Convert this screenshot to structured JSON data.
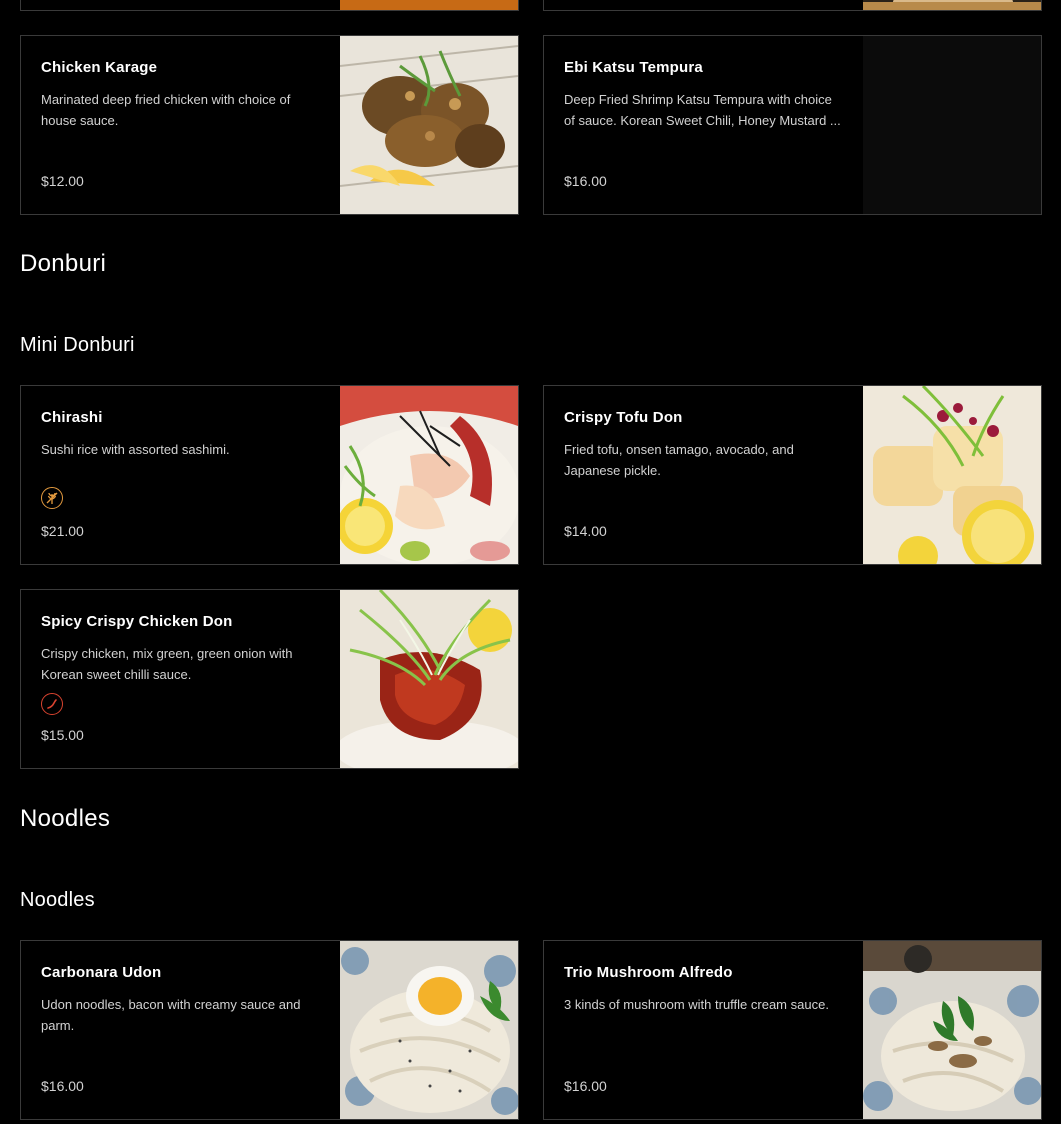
{
  "colors": {
    "background": "#000000",
    "card_border": "#3a3a3a",
    "gluten_free_badge": "#e39a3f",
    "spicy_badge": "#d9432f"
  },
  "top_partial_cards": [
    {
      "image": "food-photo"
    },
    {
      "image": "food-photo"
    }
  ],
  "appetizers": [
    {
      "name": "Chicken Karage",
      "description": "Marinated deep fried chicken with choice of house sauce.",
      "price": "$12.00",
      "image": "fried-chicken-photo"
    },
    {
      "name": "Ebi Katsu Tempura",
      "description": "Deep Fried Shrimp Katsu Tempura with choice of sauce. Korean Sweet Chili, Honey Mustard ...",
      "price": "$16.00",
      "image": "empty-photo-placeholder"
    }
  ],
  "sections": {
    "donburi": {
      "title": "Donburi",
      "subtitle": "Mini Donburi",
      "items": [
        {
          "name": "Chirashi",
          "description": "Sushi rice with assorted sashimi.",
          "price": "$21.00",
          "badge": "gluten-free-icon",
          "image": "sashimi-bowl-photo"
        },
        {
          "name": "Crispy Tofu Don",
          "description": "Fried tofu, onsen tamago, avocado, and Japanese pickle.",
          "price": "$14.00",
          "image": "tofu-bowl-photo"
        },
        {
          "name": "Spicy Crispy Chicken Don",
          "description": "Crispy chicken, mix green, green onion with Korean sweet chilli sauce.",
          "price": "$15.00",
          "badge": "chili-pepper-icon",
          "image": "chicken-bowl-photo"
        }
      ]
    },
    "noodles": {
      "title": "Noodles",
      "subtitle": "Noodles",
      "items": [
        {
          "name": "Carbonara Udon",
          "description": "Udon noodles, bacon with creamy sauce and parm.",
          "price": "$16.00",
          "image": "carbonara-udon-photo"
        },
        {
          "name": "Trio Mushroom Alfredo",
          "description": "3 kinds of mushroom with truffle cream sauce.",
          "price": "$16.00",
          "image": "mushroom-alfredo-photo"
        }
      ]
    }
  }
}
